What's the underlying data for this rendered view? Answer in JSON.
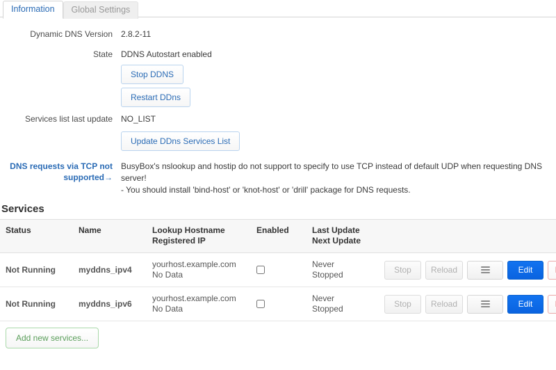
{
  "tabs": [
    {
      "label": "Information",
      "active": true
    },
    {
      "label": "Global Settings",
      "active": false
    }
  ],
  "info": {
    "version_label": "Dynamic DNS Version",
    "version_value": "2.8.2-11",
    "state_label": "State",
    "state_value": "DDNS Autostart enabled",
    "stop_ddns_button": "Stop DDNS",
    "restart_ddns_button": "Restart DDns",
    "services_update_label": "Services list last update",
    "services_update_value": "NO_LIST",
    "update_services_button": "Update DDns Services List",
    "tcp_warning_label": "DNS requests via TCP not supported→",
    "tcp_warning_line1": "BusyBox's nslookup and hostip do not support to specify to use TCP instead of default UDP when requesting DNS server!",
    "tcp_warning_line2": "- You should install 'bind-host' or 'knot-host' or 'drill' package for DNS requests."
  },
  "services": {
    "title": "Services",
    "columns": {
      "status": "Status",
      "name": "Name",
      "host_line1": "Lookup Hostname",
      "host_line2": "Registered IP",
      "enabled": "Enabled",
      "update_line1": "Last Update",
      "update_line2": "Next Update"
    },
    "rows": [
      {
        "status": "Not Running",
        "name": "myddns_ipv4",
        "hostname": "yourhost.example.com",
        "registered_ip": "No Data",
        "enabled": false,
        "last_update": "Never",
        "next_update": "Stopped",
        "stop_button": "Stop",
        "reload_button": "Reload",
        "menu_button": "☰",
        "edit_button": "Edit",
        "delete_button": "Delete"
      },
      {
        "status": "Not Running",
        "name": "myddns_ipv6",
        "hostname": "yourhost.example.com",
        "registered_ip": "No Data",
        "enabled": false,
        "last_update": "Never",
        "next_update": "Stopped",
        "stop_button": "Stop",
        "reload_button": "Reload",
        "menu_button": "☰",
        "edit_button": "Edit",
        "delete_button": "Delete"
      }
    ],
    "add_button": "Add new services..."
  },
  "colors": {
    "accent_blue": "#2a6bb5",
    "edit_blue": "#0d6efd",
    "delete_red": "#e06666",
    "add_green": "#5a9e5a"
  }
}
